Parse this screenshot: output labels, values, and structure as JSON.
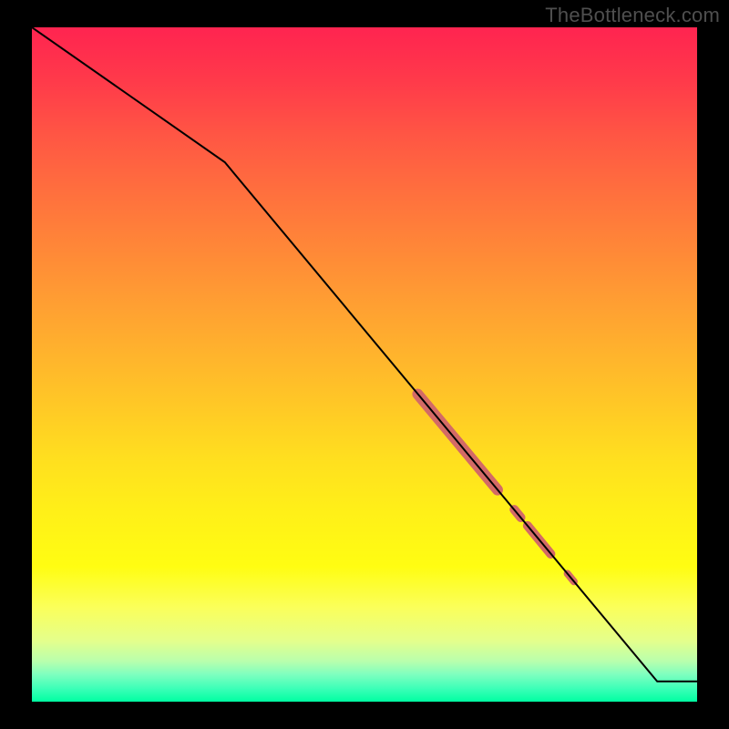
{
  "attribution": "TheBottleneck.com",
  "chart_data": {
    "type": "line",
    "title": "",
    "xlabel": "",
    "ylabel": "",
    "xlim": [
      0,
      100
    ],
    "ylim": [
      0,
      100
    ],
    "grid": false,
    "series": [
      {
        "name": "main-curve",
        "x": [
          0,
          29,
          94,
          100
        ],
        "values": [
          100,
          80,
          3,
          3
        ],
        "color": "#000000",
        "width": 2
      }
    ],
    "highlights": [
      {
        "name": "seg-a",
        "x0": 58,
        "y0": 45.6,
        "x1": 70,
        "y1": 31.4,
        "color": "#d36a66",
        "width": 12
      },
      {
        "name": "seg-b",
        "x0": 72.5,
        "y0": 28.5,
        "x1": 73.5,
        "y1": 27.3,
        "color": "#d36a66",
        "width": 10
      },
      {
        "name": "seg-c",
        "x0": 74.5,
        "y0": 26.1,
        "x1": 78,
        "y1": 21.9,
        "color": "#d36a66",
        "width": 10
      },
      {
        "name": "seg-d",
        "x0": 80.5,
        "y0": 19.0,
        "x1": 81.5,
        "y1": 17.8,
        "color": "#d36a66",
        "width": 8
      }
    ]
  }
}
